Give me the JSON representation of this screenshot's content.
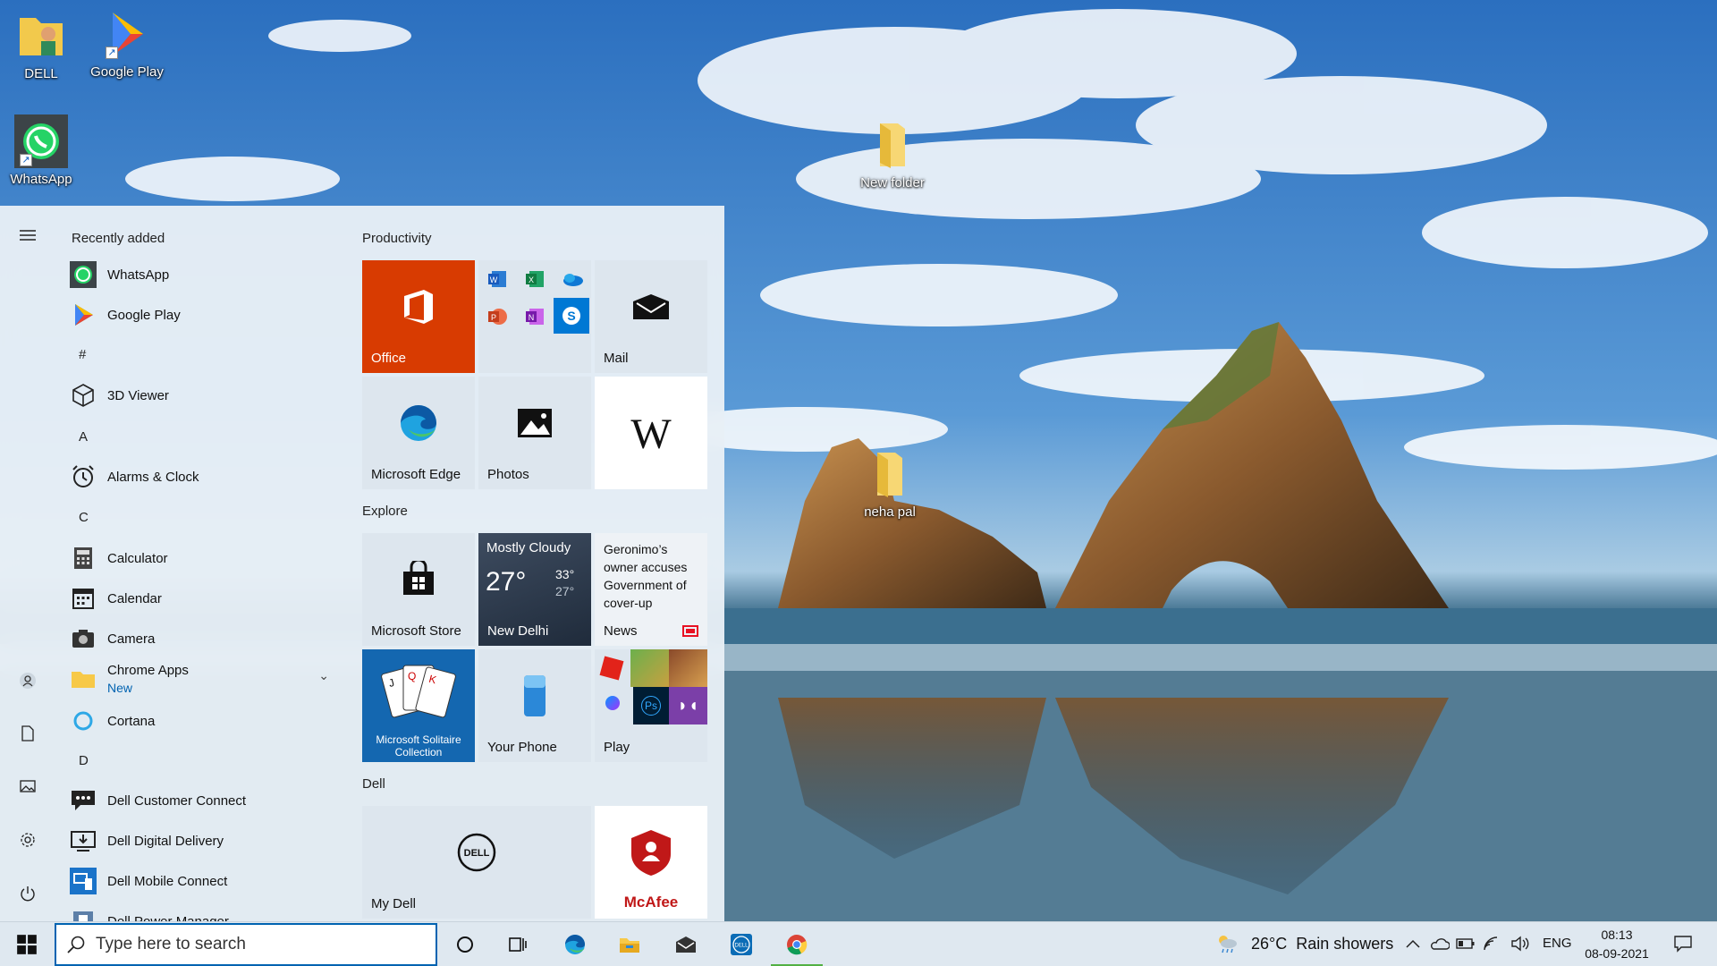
{
  "desktop": {
    "icons": [
      {
        "label": "DELL"
      },
      {
        "label": "Google Play"
      },
      {
        "label": "WhatsApp"
      },
      {
        "label": "New folder"
      },
      {
        "label": "neha pal"
      }
    ]
  },
  "start_menu": {
    "recently_added_header": "Recently added",
    "apps": [
      {
        "label": "WhatsApp",
        "icon": "whatsapp-icon"
      },
      {
        "label": "Google Play",
        "icon": "google-play-icon"
      },
      {
        "letter": "#"
      },
      {
        "label": "3D Viewer",
        "icon": "cube-icon"
      },
      {
        "letter": "A"
      },
      {
        "label": "Alarms & Clock",
        "icon": "alarm-clock-icon"
      },
      {
        "letter": "C"
      },
      {
        "label": "Calculator",
        "icon": "calculator-icon"
      },
      {
        "label": "Calendar",
        "icon": "calendar-icon"
      },
      {
        "label": "Camera",
        "icon": "camera-icon"
      },
      {
        "label": "Chrome Apps",
        "sub": "New",
        "icon": "folder-icon"
      },
      {
        "label": "Cortana",
        "icon": "cortana-icon"
      },
      {
        "letter": "D"
      },
      {
        "label": "Dell Customer Connect",
        "icon": "chat-icon"
      },
      {
        "label": "Dell Digital Delivery",
        "icon": "delivery-icon"
      },
      {
        "label": "Dell Mobile Connect",
        "icon": "mobile-connect-icon"
      },
      {
        "label": "Dell Power Manager",
        "icon": "power-manager-icon"
      }
    ],
    "groups": [
      {
        "title": "Productivity"
      },
      {
        "title": "Explore"
      },
      {
        "title": "Dell"
      }
    ],
    "tiles": {
      "office": "Office",
      "mail": "Mail",
      "edge": "Microsoft Edge",
      "photos": "Photos",
      "store": "Microsoft Store",
      "weather": {
        "condition": "Mostly Cloudy",
        "temp": "27°",
        "high": "33°",
        "low": "27°",
        "city": "New Delhi"
      },
      "news": {
        "headline": "Geronimo’s owner accuses Government of cover-up",
        "label": "News"
      },
      "solitaire": "Microsoft Solitaire Collection",
      "your_phone": "Your Phone",
      "play": "Play",
      "my_dell": "My Dell",
      "mcafee": "McAfee"
    }
  },
  "taskbar": {
    "search_placeholder": "Type here to search",
    "weather": "26°C  Rain showers",
    "language": "ENG",
    "time": "08:13",
    "date": "08-09-2021"
  },
  "colors": {
    "accent": "#0063b1",
    "office_tile": "#d83b01",
    "start_bg": "#e8eff6",
    "taskbar_bg": "#dfe8f0"
  }
}
